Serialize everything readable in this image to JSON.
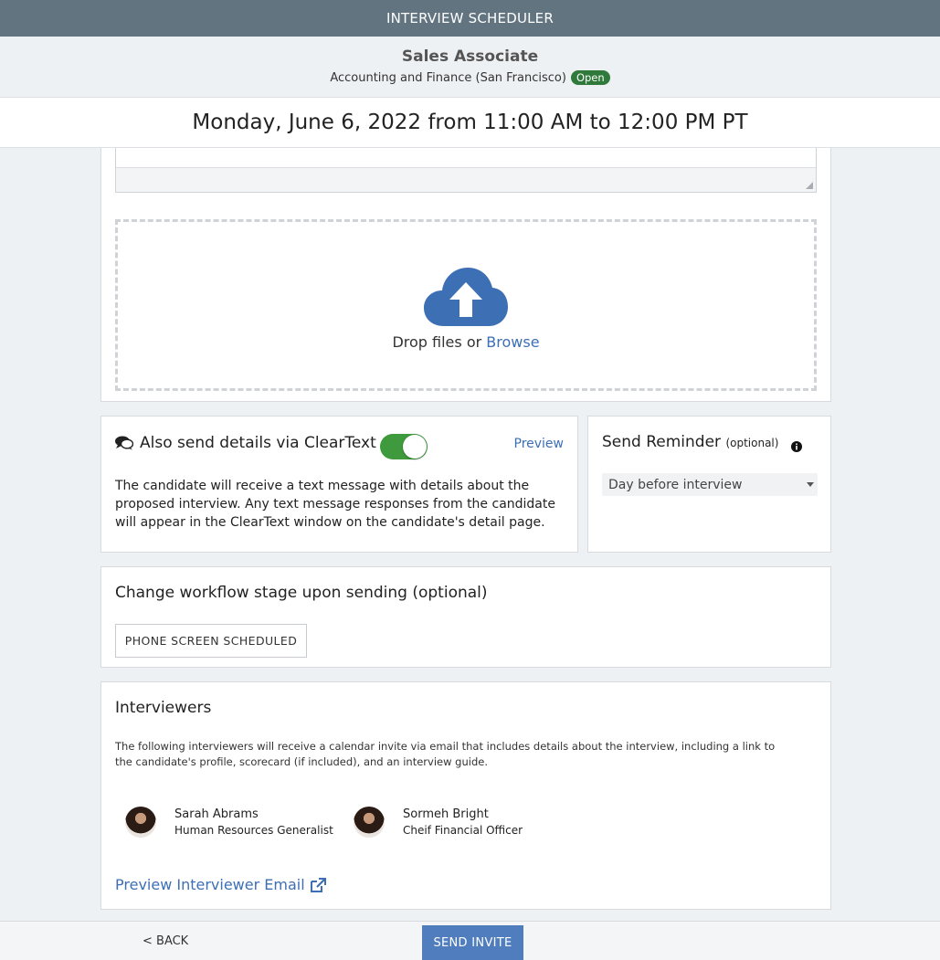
{
  "app": {
    "title": "INTERVIEW SCHEDULER"
  },
  "job": {
    "title": "Sales Associate",
    "department": "Accounting and Finance (San Francisco)",
    "status": "Open"
  },
  "schedule": {
    "datetime": "Monday, June 6, 2022 from 11:00 AM to 12:00 PM PT"
  },
  "upload": {
    "drop_text": "Drop files or",
    "browse_label": "Browse",
    "icon": "cloud-upload-icon"
  },
  "cleartext": {
    "label": "Also send details via ClearText",
    "enabled": true,
    "preview_label": "Preview",
    "description": "The candidate will receive a text message with details about the proposed interview. Any text message responses from the candidate will appear in the ClearText window on the candidate's detail page.",
    "icon": "chat-bubbles-icon"
  },
  "reminder": {
    "label": "Send Reminder",
    "optional_label": "(optional)",
    "selected": "Day before interview",
    "icon": "info-icon"
  },
  "workflow": {
    "label": "Change workflow stage upon sending (optional)",
    "stage_button": "PHONE SCREEN SCHEDULED"
  },
  "interviewers": {
    "label": "Interviewers",
    "description": "The following interviewers will receive a calendar invite via email that includes details about the interview, including a link to the candidate's profile, scorecard (if included), and an interview guide.",
    "people": [
      {
        "name": "Sarah Abrams",
        "role": "Human Resources Generalist"
      },
      {
        "name": "Sormeh Bright",
        "role": "Cheif Financial Officer"
      }
    ],
    "preview_email_label": "Preview Interviewer Email",
    "link_icon": "external-link-icon"
  },
  "footer": {
    "back_label": "< BACK",
    "send_label": "SEND INVITE"
  },
  "colors": {
    "topbar": "#617480",
    "accent": "#3d6fb4",
    "toggle_on": "#3e9a3c",
    "badge": "#2f7a3b",
    "send_button": "#4f7dbd"
  }
}
